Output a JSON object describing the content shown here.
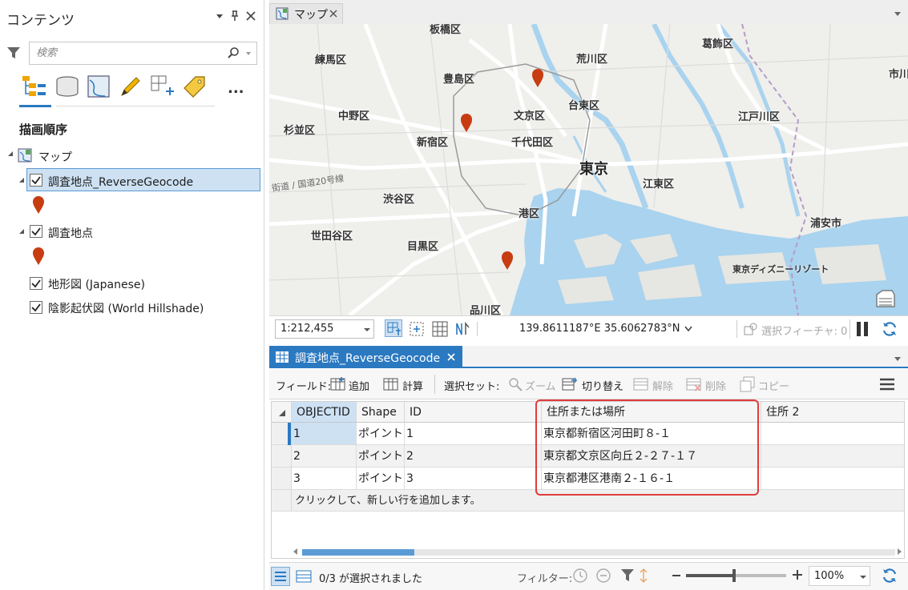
{
  "contents": {
    "title": "コンテンツ",
    "search_placeholder": "検索",
    "more_label": "...",
    "section": "描画順序",
    "map_name": "マップ",
    "layers": [
      {
        "name": "調査地点_ReverseGeocode",
        "checked": true
      },
      {
        "name": "調査地点",
        "checked": true
      },
      {
        "name": "地形図 (Japanese)",
        "checked": true
      },
      {
        "name": "陰影起伏図 (World Hillshade)",
        "checked": true
      }
    ],
    "marker_color": "#c83c12"
  },
  "map": {
    "tab_label": "マップ",
    "labels": [
      "板橋区",
      "葛飾区",
      "練馬区",
      "荒川区",
      "豊島区",
      "台東区",
      "文京区",
      "中野区",
      "江戸川区",
      "杉並区",
      "新宿区",
      "千代田区",
      "東京",
      "江東区",
      "渋谷区",
      "港区",
      "浦安市",
      "世田谷区",
      "目黒区",
      "東京ディズニーリゾート",
      "品川区",
      "市川",
      "街道 / 国道20号線"
    ],
    "scale": "1:212,455",
    "coordinates": "139.8611187°E 35.6062783°N",
    "selected_features": "選択フィーチャ: 0"
  },
  "table": {
    "tab_label": "調査地点_ReverseGeocode",
    "toolbar": {
      "fields_label": "フィールド:",
      "add_label": "追加",
      "calculate_label": "計算",
      "selection_label": "選択セット:",
      "zoom_label": "ズーム",
      "switch_label": "切り替え",
      "clear_label": "解除",
      "delete_label": "削除",
      "copy_label": "コピー"
    },
    "columns": [
      "OBJECTID",
      "Shape",
      "ID",
      "住所または場所",
      "住所 2"
    ],
    "rows": [
      {
        "objectid": "1",
        "shape": "ポイント Z",
        "id": "1",
        "address": "東京都新宿区河田町８-１"
      },
      {
        "objectid": "2",
        "shape": "ポイント Z",
        "id": "2",
        "address": "東京都文京区向丘２-２７-１７"
      },
      {
        "objectid": "3",
        "shape": "ポイント Z",
        "id": "3",
        "address": "東京都港区港南２-１６-１"
      }
    ],
    "add_row_hint": "クリックして、新しい行を追加します。",
    "selection_status": "0/3 が選択されました",
    "filter_label": "フィルター:",
    "zoom_percent": "100%"
  },
  "colors": {
    "accent": "#2b79c1",
    "highlight": "#e03c3c",
    "selection_bg": "#cde1f3"
  }
}
